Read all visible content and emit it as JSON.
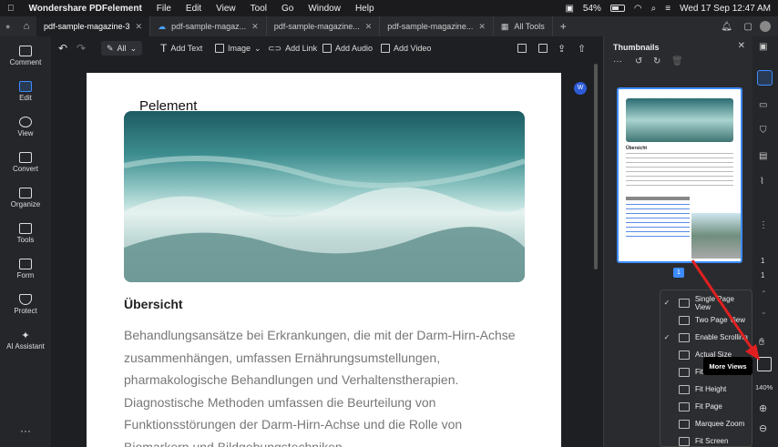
{
  "menubar": {
    "apple": "",
    "app_name": "Wondershare PDFelement",
    "items": [
      "File",
      "Edit",
      "View",
      "Tool",
      "Go",
      "Window",
      "Help"
    ],
    "battery": "54%",
    "datetime": "Wed 17 Sep  12:47 AM"
  },
  "tabs": [
    {
      "label": "pdf-sample-magazine-3",
      "active": true
    },
    {
      "label": "pdf-sample-magaz...",
      "active": false
    },
    {
      "label": "pdf-sample-magazine...",
      "active": false
    },
    {
      "label": "pdf-sample-magazine...",
      "active": false
    },
    {
      "label": "All Tools",
      "active": false
    }
  ],
  "new_tab": "+",
  "left_rail": [
    "Comment",
    "Edit",
    "View",
    "Convert",
    "Organize",
    "Tools",
    "Form",
    "Protect",
    "AI Assistant"
  ],
  "more": "···",
  "toolbar": {
    "all_label": "All",
    "add_text": "Add Text",
    "image": "Image",
    "add_link": "Add Link",
    "add_audio": "Add Audio",
    "add_video": "Add Video"
  },
  "document": {
    "heading_fragment": "Pelement",
    "section_title": "Übersicht",
    "paragraph_lines": [
      "Behandlungsansätze bei Erkrankungen, die mit der Darm-Hirn-Achse",
      "zusammenhängen, umfassen Ernährungsumstellungen,",
      "pharmakologische Behandlungen und Verhaltenstherapien.",
      "Diagnostische Methoden umfassen die Beurteilung von",
      "Funktionsstörungen der Darm-Hirn-Achse und die Rolle von",
      "Biomarkern und Bildgebungstechniken."
    ]
  },
  "thumbnails": {
    "title": "Thumbnails",
    "page_number": "1",
    "thumb_heading": "Übersicht"
  },
  "right_rail": {
    "page_current": "1",
    "page_total": "1",
    "zoom": "140%"
  },
  "view_menu": {
    "items": [
      {
        "label": "Single Page View",
        "checked": true
      },
      {
        "label": "Two Page View",
        "checked": false
      },
      {
        "label": "Enable Scrolling",
        "checked": true
      },
      {
        "label": "Actual Size",
        "checked": false
      },
      {
        "label": "Fit Width",
        "checked": false
      },
      {
        "label": "Fit Height",
        "checked": false
      },
      {
        "label": "Fit Page",
        "checked": false
      },
      {
        "label": "Marquee Zoom",
        "checked": false
      },
      {
        "label": "Fit Screen",
        "checked": false
      }
    ]
  },
  "tooltip": "More Views",
  "colors": {
    "accent": "#3d8cff",
    "arrow": "#e02020"
  }
}
